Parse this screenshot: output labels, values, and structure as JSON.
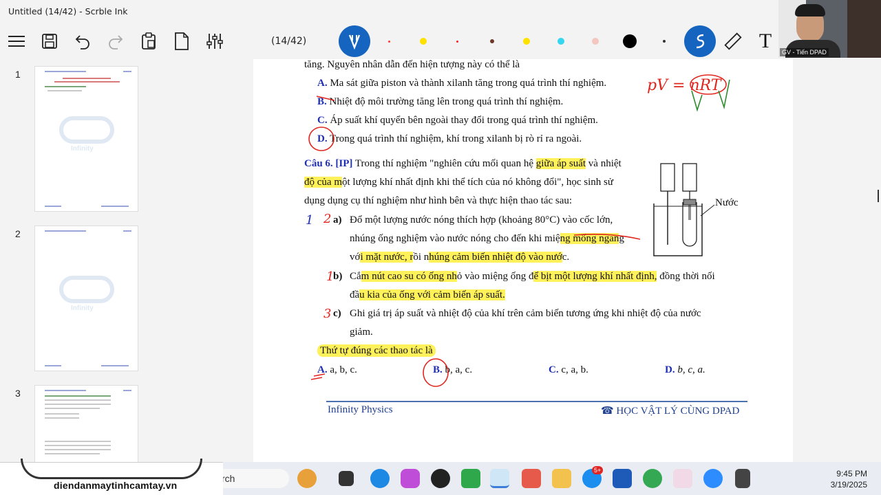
{
  "window": {
    "title": "Untitled (14/42) - Scrble Ink"
  },
  "toolbar": {
    "page_counter": "(14/42)",
    "colors": [
      "#ff3b30",
      "#ffe100",
      "#ff2020",
      "#6b3a2a",
      "#ffe100",
      "#34d6f0",
      "#f3c6c0",
      "#000000",
      "#333333"
    ],
    "text_tool": "T"
  },
  "sidebar": {
    "pages": [
      "1",
      "2",
      "3"
    ]
  },
  "document": {
    "l1": "tăng. Nguyên nhân dẫn đến hiện tượng này có thể là",
    "optA_label": "A.",
    "optA": "Ma sát giữa piston và thành xilanh tăng trong quá trình thí nghiệm.",
    "optB_label": "B.",
    "optB": "Nhiệt độ môi trường tăng lên trong quá trình thí nghiệm.",
    "optC_label": "C.",
    "optC": "Áp suất khí quyển bên ngoài thay đổi trong quá trình thí nghiệm.",
    "optD_label": "D.",
    "optD": "Trong quá trình thí nghiệm, khí trong xilanh bị rò rỉ ra ngoài.",
    "q6_label": "Câu 6. [IP]",
    "q6_l1a": "Trong thí nghiệm \"nghiên cứu mối quan hệ ",
    "q6_l1b": "giữa áp suất",
    "q6_l1c": " và nhiệt",
    "q6_l2a": "độ của m",
    "q6_l2b": "ột lượng khí nhất định khi thể tích của nó không đổi\", học sinh sử",
    "q6_l3": "dụng dụng cụ thí nghiệm như hình bên và thực hiện thao tác sau:",
    "water_label": "Nước",
    "a_label": "a)",
    "a_l1": "Đổ một lượng nước nóng thích hợp (khoảng 80°C) vào cốc lớn,",
    "a_l2a": "nhúng ống nghiệm vào nước nóng cho đến khi miệ",
    "a_l2b": "ng mống ngan",
    "a_l2c": "g",
    "a_l3a": "vớ",
    "a_l3b": "i mặt nước, r",
    "a_l3c": "ồi n",
    "a_l3d": "húng cảm biến nhiệt độ vào nướ",
    "a_l3e": "c.",
    "b_label": "b)",
    "b_l1a": "Cắ",
    "b_l1b": "m nút cao su có ống nh",
    "b_l1c": "ỏ vào miệng ống đ",
    "b_l1d": "ể bịt một lượng khí nhất định,",
    "b_l1e": " đồng thời nối",
    "b_l2a": "đầ",
    "b_l2b": "u kia của ống với cảm biến áp suất.",
    "c_label": "c)",
    "c_l1": "Ghi giá trị áp suất và nhiệt độ của khí trên cảm biến tương ứng khi nhiệt độ của nước",
    "c_l2": "giảm.",
    "order_text": "Thứ tự đúng các thao tác là",
    "ansA_label": "A.",
    "ansA": "a, b, c.",
    "ansB_label": "B.",
    "ansB": "b, a, c.",
    "ansC_label": "C.",
    "ansC": "c, a, b.",
    "ansD_label": "D.",
    "ansD": "b, c, a.",
    "footer_left": "Infinity Physics",
    "footer_right": "☎ HỌC VẬT LÝ CÙNG DPAD"
  },
  "ink": {
    "formula": "pV = nRT",
    "n1": "1",
    "n2": "2",
    "n3": "1",
    "n4": "3"
  },
  "webcam": {
    "label": "GV - Tiến DPAD"
  },
  "taskbar": {
    "search_text": "rch",
    "website": "diendanmaytinhcamtay.vn",
    "notification_badge": "5+",
    "time": "9:45 PM",
    "date": "3/19/2025"
  }
}
